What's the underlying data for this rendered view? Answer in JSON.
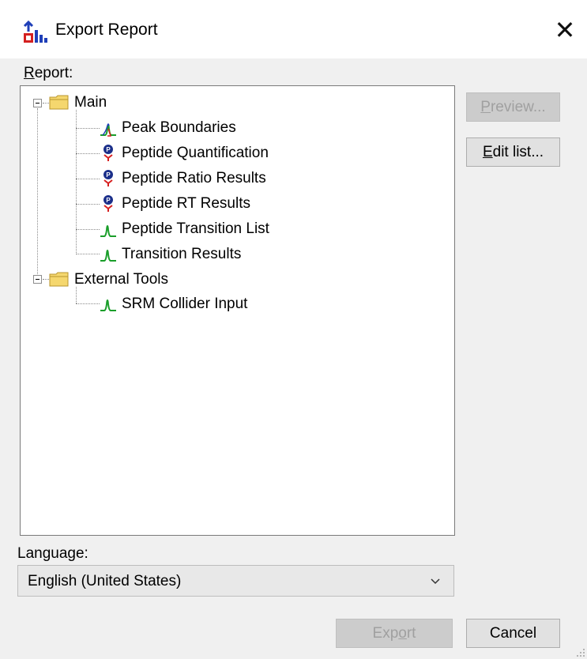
{
  "window": {
    "title": "Export Report",
    "close_glyph": "✕"
  },
  "report_label": "Report:",
  "tree": {
    "folders": [
      {
        "label": "Main",
        "icon": "folder-icon",
        "items": [
          {
            "label": "Peak Boundaries",
            "icon": "peak-boundaries-icon"
          },
          {
            "label": "Peptide Quantification",
            "icon": "peptide-icon"
          },
          {
            "label": "Peptide Ratio Results",
            "icon": "peptide-icon"
          },
          {
            "label": "Peptide RT Results",
            "icon": "peptide-icon"
          },
          {
            "label": "Peptide Transition List",
            "icon": "transition-peak-icon"
          },
          {
            "label": "Transition Results",
            "icon": "transition-peak-icon"
          }
        ]
      },
      {
        "label": "External Tools",
        "icon": "folder-icon",
        "items": [
          {
            "label": "SRM Collider Input",
            "icon": "transition-peak-icon"
          }
        ]
      }
    ]
  },
  "buttons": {
    "preview": "Preview...",
    "edit_list": "Edit list...",
    "export": "Export",
    "cancel": "Cancel"
  },
  "language": {
    "label": "Language:",
    "value": "English (United States)"
  },
  "colors": {
    "peak_green": "#1a9e2a",
    "peak_blue": "#1f3fb8",
    "peak_red": "#d42020",
    "peptide_blue": "#1b2f8a",
    "peptide_red": "#d62020",
    "folder_yellow": "#f5d76e"
  }
}
